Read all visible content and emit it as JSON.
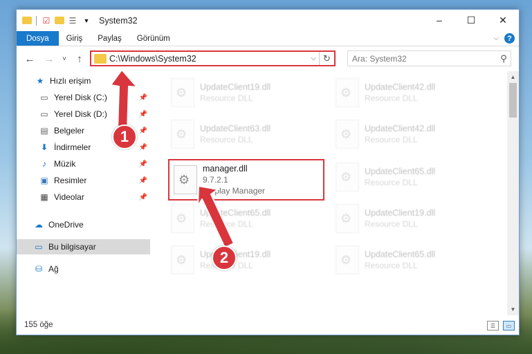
{
  "window": {
    "title": "System32",
    "controls": [
      "–",
      "☐",
      "✕"
    ]
  },
  "ribbon": {
    "tabs": [
      "Dosya",
      "Giriş",
      "Paylaş",
      "Görünüm"
    ],
    "active_index": 0,
    "help": "?"
  },
  "nav": {
    "back": "←",
    "forward": "→",
    "recent": "˅",
    "up": "↑"
  },
  "address": {
    "path": "C:\\Windows\\System32",
    "dropdown": "⌵",
    "refresh": "↻"
  },
  "search": {
    "placeholder": "Ara: System32",
    "icon": "search-icon"
  },
  "sidebar": {
    "items": [
      {
        "label": "Hızlı erişim",
        "icon": "star-icon"
      },
      {
        "label": "Yerel Disk (C:)",
        "icon": "drive-icon"
      },
      {
        "label": "Yerel Disk (D:)",
        "icon": "drive-icon"
      },
      {
        "label": "Belgeler",
        "icon": "document-icon"
      },
      {
        "label": "İndirmeler",
        "icon": "download-icon"
      },
      {
        "label": "Müzik",
        "icon": "music-icon"
      },
      {
        "label": "Resimler",
        "icon": "pictures-icon"
      },
      {
        "label": "Videolar",
        "icon": "video-icon"
      },
      {
        "label": "OneDrive",
        "icon": "cloud-icon"
      },
      {
        "label": "Bu bilgisayar",
        "icon": "computer-icon"
      },
      {
        "label": "Ağ",
        "icon": "network-icon"
      }
    ]
  },
  "files": [
    {
      "name": "UpdateClient19.dll",
      "sub1": "Resource DLL",
      "sub2": ""
    },
    {
      "name": "UpdateClient42.dll",
      "sub1": "Resource DLL",
      "sub2": ""
    },
    {
      "name": "UpdateClient63.dll",
      "sub1": "Resource DLL",
      "sub2": ""
    },
    {
      "name": "UpdateClient42.dll",
      "sub1": "Resource DLL",
      "sub2": ""
    },
    {
      "name": "manager.dll",
      "sub1": "9.7.2.1",
      "sub2": "Display Manager"
    },
    {
      "name": "UpdateClient65.dll",
      "sub1": "Resource DLL",
      "sub2": ""
    },
    {
      "name": "UpdateClient65.dll",
      "sub1": "Resource DLL",
      "sub2": ""
    },
    {
      "name": "UpdateClient19.dll",
      "sub1": "Resource DLL",
      "sub2": ""
    },
    {
      "name": "UpdateClient19.dll",
      "sub1": "Resource DLL",
      "sub2": ""
    },
    {
      "name": "UpdateClient65.dll",
      "sub1": "Resource DLL",
      "sub2": ""
    }
  ],
  "status": {
    "count": "155 öğe"
  },
  "annotations": {
    "step1": "1",
    "step2": "2"
  },
  "colors": {
    "accent": "#1979ca",
    "highlight": "#d9353d",
    "selection": "#cce8ff"
  }
}
